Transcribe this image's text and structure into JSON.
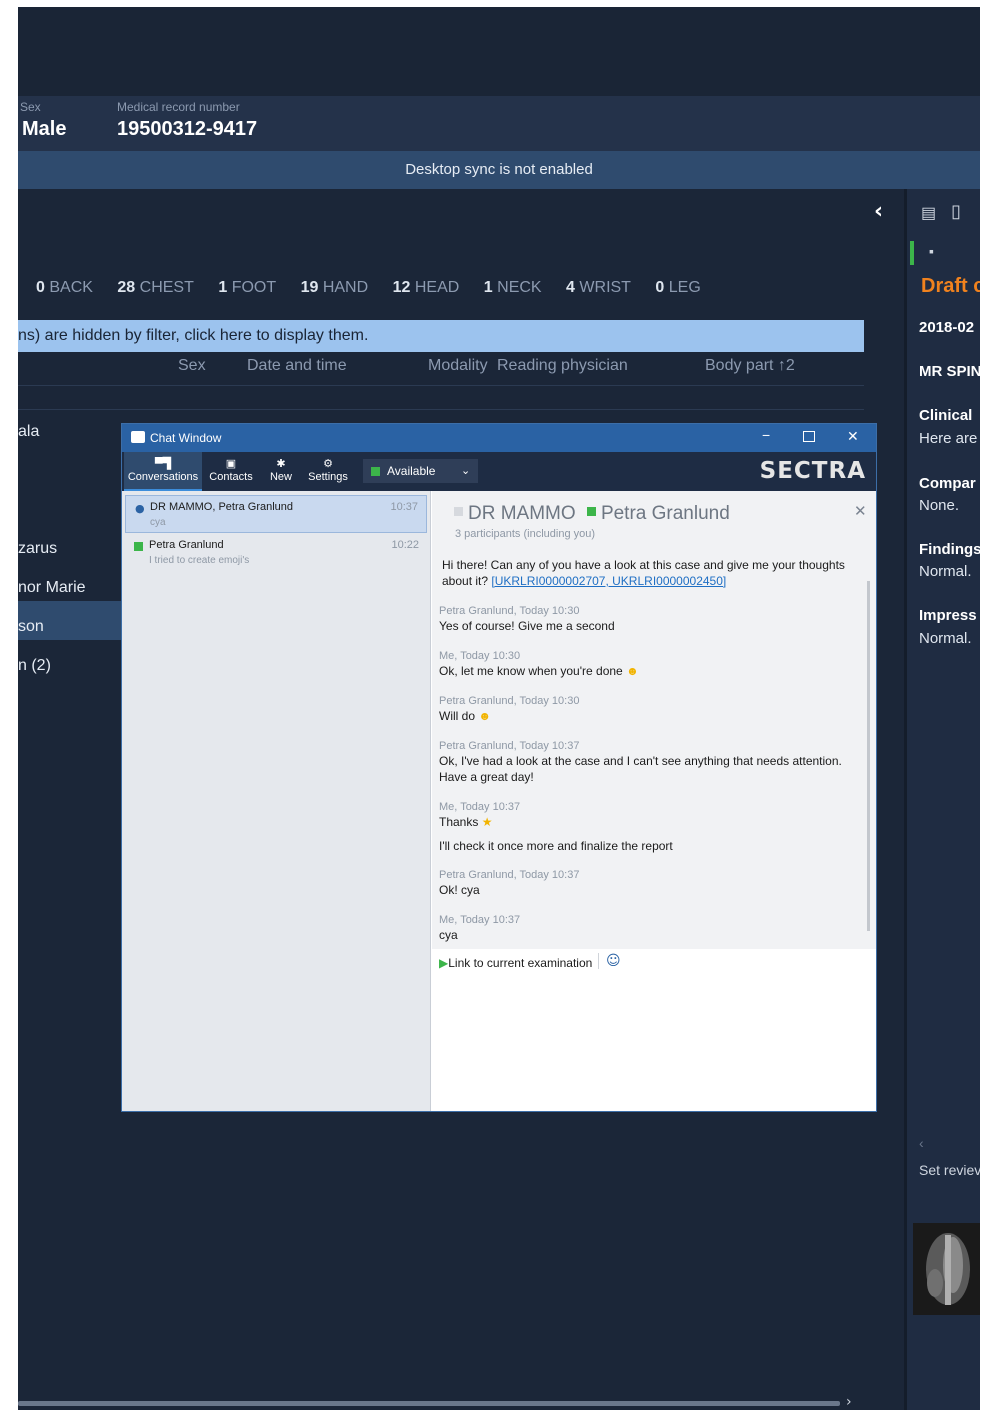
{
  "patient": {
    "sex_label": "Sex",
    "sex_value": "Male",
    "mrn_label": "Medical record number",
    "mrn_value": "19500312-9417"
  },
  "sync_message": "Desktop sync is not enabled",
  "body_parts": [
    {
      "count": "0",
      "name": "BACK"
    },
    {
      "count": "28",
      "name": "CHEST"
    },
    {
      "count": "1",
      "name": "FOOT"
    },
    {
      "count": "19",
      "name": "HAND"
    },
    {
      "count": "12",
      "name": "HEAD"
    },
    {
      "count": "1",
      "name": "NECK"
    },
    {
      "count": "4",
      "name": "WRIST"
    },
    {
      "count": "0",
      "name": "LEG"
    }
  ],
  "filter_message": "ns) are hidden by filter, click here to display them.",
  "columns": {
    "sex": "Sex",
    "date_time": "Date and time",
    "modality": "Modality",
    "reading_physician": "Reading physician",
    "body_part": "Body part ↑2"
  },
  "patient_rows": [
    "ala",
    "zarus",
    "nor Marie",
    "son",
    "n (2)"
  ],
  "right_panel": {
    "draft": "Draft c",
    "date": "2018-02",
    "exam": "MR SPIN",
    "clinical_label": "Clinical",
    "clinical_text": "Here are",
    "comparison_label": "Compar",
    "comparison_text": "None.",
    "findings_label": "Findings",
    "findings_text": "Normal.",
    "impression_label": "Impress",
    "impression_text": "Normal.",
    "set_review": "Set reviev"
  },
  "chat": {
    "window_title": "Chat Window",
    "toolbar": {
      "conversations": "Conversations",
      "contacts": "Contacts",
      "new": "New",
      "settings": "Settings",
      "status": "Available"
    },
    "logo": "SECTRA",
    "conversations": [
      {
        "name": "DR MAMMO, Petra Granlund",
        "preview": "cya",
        "time": "10:37"
      },
      {
        "name": "Petra Granlund",
        "preview": "I tried to create emoji's",
        "time": "10:22"
      }
    ],
    "title_a": "DR MAMMO",
    "title_b": "Petra Granlund",
    "participants": "3 participants (including you)",
    "messages": [
      {
        "header": "",
        "text": "Hi there! Can any of you have a look at this case and give me your thoughts about it?",
        "link": "[UKRLRI0000002707, UKRLRI0000002450]"
      },
      {
        "header": "Petra Granlund, Today 10:30",
        "text": "Yes of course! Give me a second"
      },
      {
        "header": "Me, Today 10:30",
        "text": "Ok, let me know when you're done"
      },
      {
        "header": "Petra Granlund, Today 10:30",
        "text": "Will do"
      },
      {
        "header": "Petra Granlund, Today 10:37",
        "text": "Ok, I've had a look at the case and I can't see anything that needs attention. Have a great day!"
      },
      {
        "header": "Me, Today 10:37",
        "text": "Thanks"
      },
      {
        "header": "",
        "text": "I'll check it once more and finalize the report"
      },
      {
        "header": "Petra Granlund, Today 10:37",
        "text": "Ok! cya"
      },
      {
        "header": "Me, Today 10:37",
        "text": "cya"
      }
    ],
    "link_current": "Link to current examination"
  },
  "colors": {
    "app_bg": "#1b2638",
    "sync_bar": "#2f4b6e",
    "filter_bar": "#9cc3ee",
    "chat_title": "#2a62a4",
    "draft_orange": "#f0821e",
    "status_green": "#3cb54a"
  }
}
